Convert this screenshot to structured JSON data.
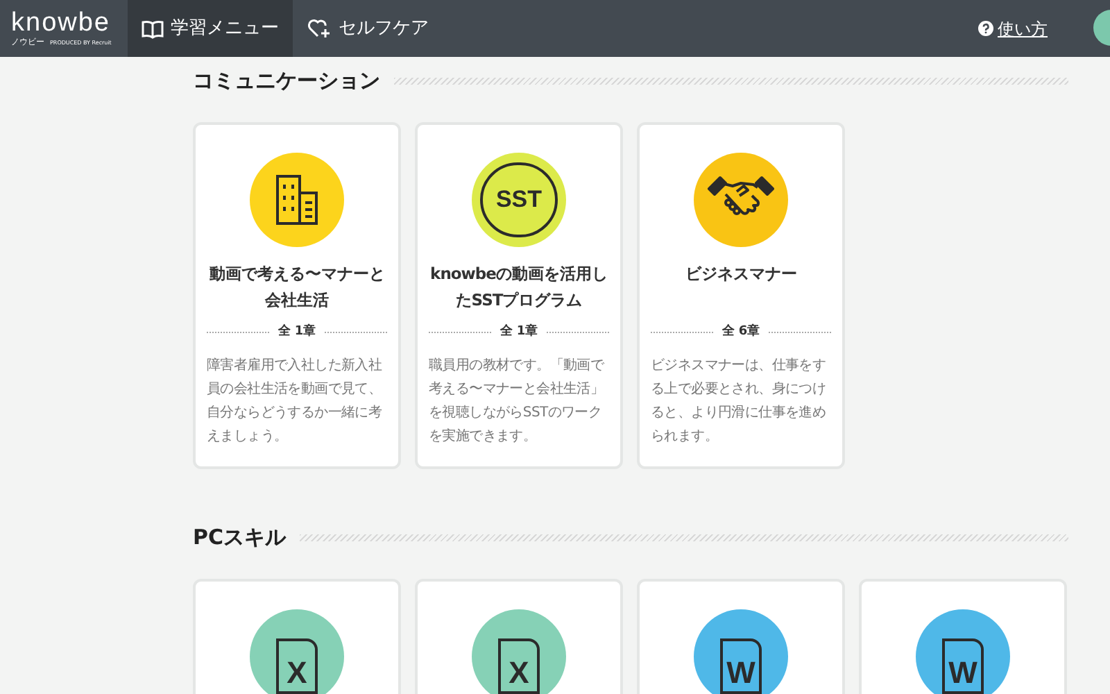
{
  "header": {
    "logo": "knowbe",
    "logo_sub": "ノウビー",
    "logo_credit": "PRODUCED BY Recruit",
    "nav": [
      {
        "label": "学習メニュー",
        "kind": "book",
        "selected": true
      },
      {
        "label": "セルフケア",
        "kind": "heart",
        "selected": false
      }
    ],
    "help_link": "使い方"
  },
  "sections": [
    {
      "title": "コミュニケーション",
      "cards": [
        {
          "kind": "building",
          "color": "#fcd41c",
          "title": "動画で考える〜マナーと会社生活",
          "chapters": "全 1章",
          "description": "障害者雇用で入社した新入社員の会社生活を動画で見て、自分ならどうするか一緒に考えましょう。"
        },
        {
          "kind": "sst",
          "color": "#dcea4a",
          "icon_text": "SST",
          "title": "knowbeの動画を活用したSSTプログラム",
          "chapters": "全 1章",
          "description": "職員用の教材です。「動画で考える〜マナーと会社生活」を視聴しながらSSTのワークを実施できます。"
        },
        {
          "kind": "handshake",
          "color": "#f9c414",
          "title": "ビジネスマナー",
          "chapters": "全 6章",
          "description": "ビジネスマナーは、仕事をする上で必要とされ、身につけると、より円滑に仕事を進められます。"
        }
      ]
    },
    {
      "title": "PCスキル",
      "cards": [
        {
          "kind": "document",
          "color": "#86d1b6",
          "icon_text": "X"
        },
        {
          "kind": "document",
          "color": "#86d1b6",
          "icon_text": "X"
        },
        {
          "kind": "document",
          "color": "#4fb8e8",
          "icon_text": "W"
        },
        {
          "kind": "document",
          "color": "#4fb8e8",
          "icon_text": "W"
        }
      ]
    }
  ]
}
